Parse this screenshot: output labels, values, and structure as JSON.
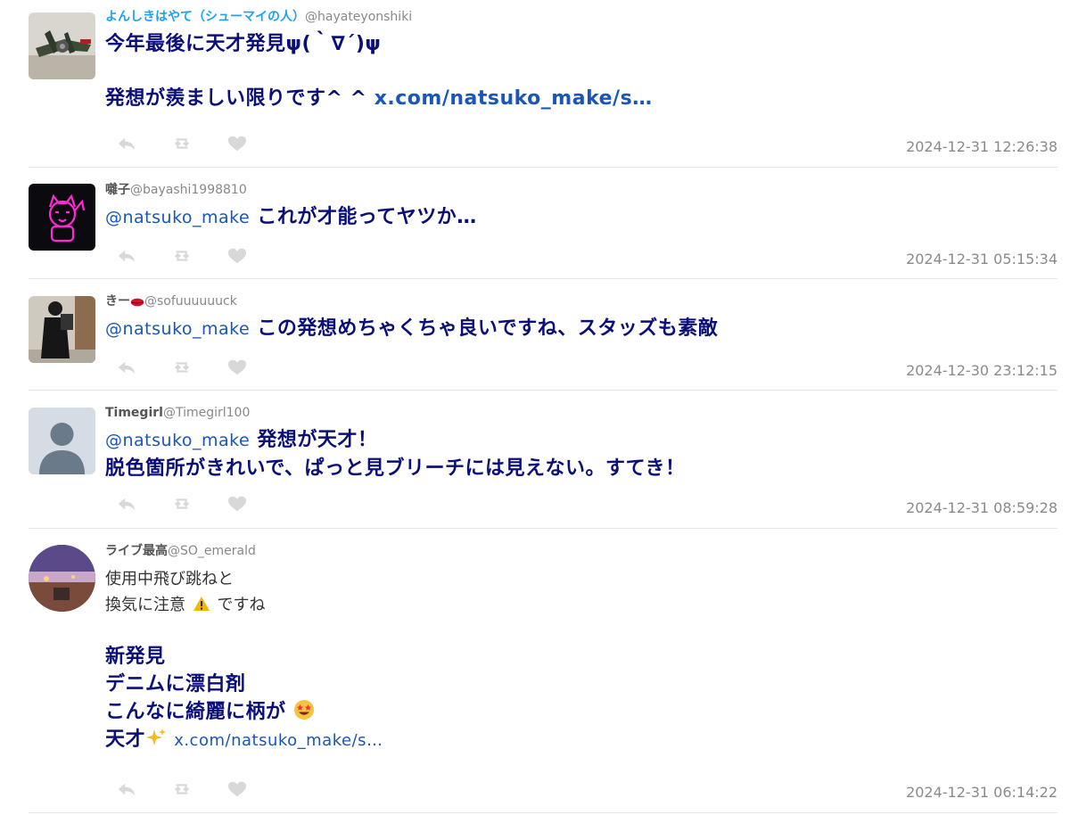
{
  "tweets": [
    {
      "display_name": "よんしきはやて（シューマイの人）",
      "name_color": "#1da1f2",
      "handle": "@hayateyonshiki",
      "line1": "今年最後に天才発見ψ(｀∇´)ψ",
      "line2": "発想が羨ましい限りです^ ^",
      "link": "x.com/natsuko_make/s…",
      "timestamp": "2024-12-31 12:26:38"
    },
    {
      "display_name": "囃子",
      "name_color": "#555555",
      "handle": "@bayashi1998810",
      "mention": "@natsuko_make",
      "line1": "これが才能ってヤツか…",
      "timestamp": "2024-12-31 05:15:34"
    },
    {
      "display_name": "きー",
      "name_color": "#555555",
      "handle": "@sofuuuuuuck",
      "mention": "@natsuko_make",
      "line1": "この発想めちゃくちゃ良いですね、スタッズも素敵",
      "timestamp": "2024-12-30 23:12:15"
    },
    {
      "display_name": "Timegirl",
      "name_color": "#555555",
      "handle": "@Timegirl100",
      "mention": "@natsuko_make",
      "line1": "発想が天才！",
      "line2": "脱色箇所がきれいで、ぱっと見ブリーチには見えない。すてき！",
      "timestamp": "2024-12-31 08:59:28"
    },
    {
      "display_name": "ライブ最高",
      "name_color": "#555555",
      "handle": "@SO_emerald",
      "plain1": "使用中飛び跳ねと",
      "plain2a": "換気に注意",
      "plain2b": "ですね",
      "bold1": "新発見",
      "bold2": "デニムに漂白剤",
      "bold3": "こんなに綺麗に柄が",
      "bold4": "天才",
      "link": "x.com/natsuko_make/s…",
      "timestamp": "2024-12-31 06:14:22"
    }
  ],
  "icons": {
    "reply": "reply-icon",
    "retweet": "retweet-icon",
    "like": "heart-icon",
    "warning": "warning-emoji-icon",
    "star_eyes": "star-struck-emoji-icon",
    "sparkles": "sparkles-emoji-icon",
    "lips": "lips-emoji-icon"
  },
  "colors": {
    "tweet_text": "#0b0f7a",
    "link": "#1a56b8",
    "muted": "#8a8a8a",
    "action_icon": "#d8d8d8"
  }
}
